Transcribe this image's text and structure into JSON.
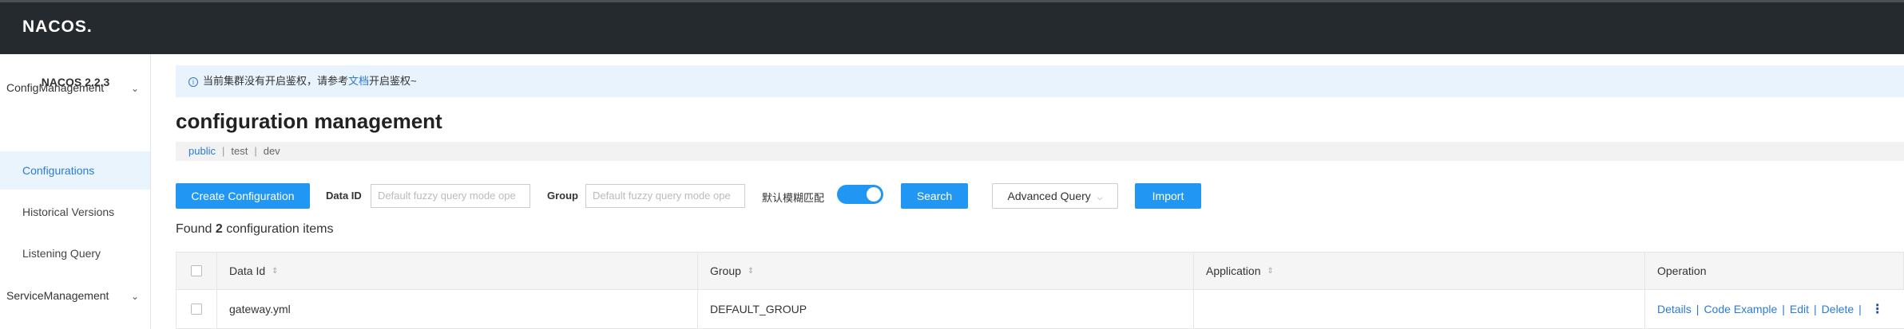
{
  "topbar": {
    "logo": "NACOS."
  },
  "sidebar": {
    "version": "NACOS 2.2.3",
    "groups": [
      {
        "label": "ConfigManagement",
        "chevron": "chevron-down-icon"
      },
      {
        "label": "ServiceManagement",
        "chevron": "chevron-down-icon"
      }
    ],
    "items": [
      {
        "label": "Configurations",
        "active": true
      },
      {
        "label": "Historical Versions",
        "active": false
      },
      {
        "label": "Listening Query",
        "active": false
      }
    ]
  },
  "notice": {
    "text_before": "当前集群没有开启鉴权，请参考",
    "link": "文档",
    "text_after": "开启鉴权~"
  },
  "page": {
    "title": "configuration management"
  },
  "namespaces": [
    "public",
    "test",
    "dev"
  ],
  "toolbar": {
    "create_label": "Create Configuration",
    "data_id_label": "Data ID",
    "data_id_placeholder": "Default fuzzy query mode ope",
    "group_label": "Group",
    "group_placeholder": "Default fuzzy query mode ope",
    "fuzzy_label": "默认模糊匹配",
    "fuzzy_enabled": true,
    "search_label": "Search",
    "advanced_label": "Advanced Query",
    "import_label": "Import"
  },
  "result": {
    "prefix": "Found",
    "count": "2",
    "suffix": "configuration items"
  },
  "table": {
    "columns": [
      "Data Id",
      "Group",
      "Application",
      "Operation"
    ],
    "rows": [
      {
        "data_id": "gateway.yml",
        "group": "DEFAULT_GROUP",
        "application": ""
      }
    ],
    "operations": [
      "Details",
      "Code Example",
      "Edit",
      "Delete"
    ]
  },
  "colors": {
    "primary": "#2196f3",
    "topbar": "#252a2f",
    "link": "#2a7bd4"
  }
}
